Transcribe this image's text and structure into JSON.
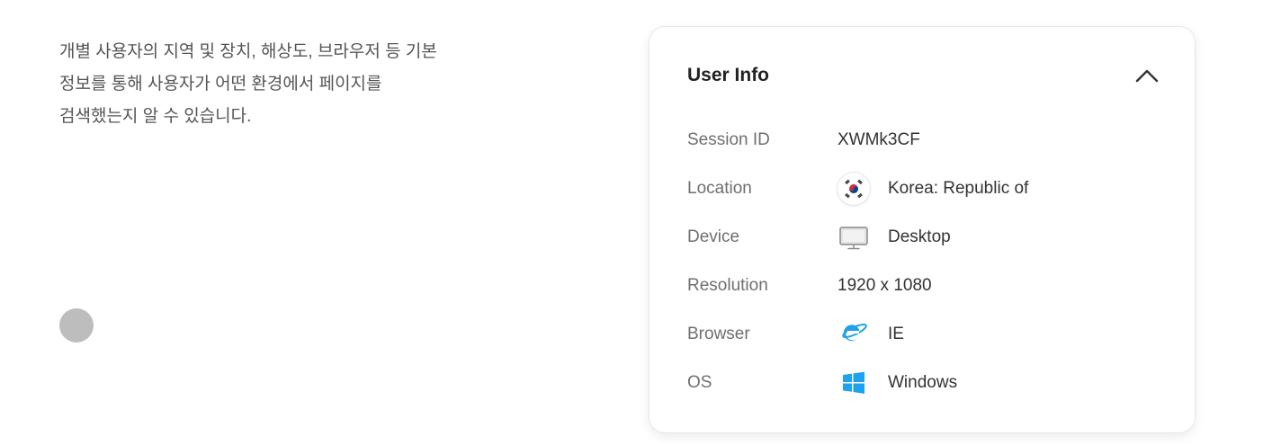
{
  "description": {
    "lines": [
      "개별 사용자의 지역 및 장치, 해상도, 브라우저 등 기본",
      "정보를 통해 사용자가 어떤 환경에서 페이지를",
      "검색했는지 알 수 있습니다."
    ]
  },
  "card": {
    "title": "User Info",
    "collapse_icon": "chevron-up-icon",
    "rows": [
      {
        "label": "Session ID",
        "value": "XWMk3CF",
        "icon": ""
      },
      {
        "label": "Location",
        "value": "Korea: Republic of",
        "icon": "korea-flag-icon"
      },
      {
        "label": "Device",
        "value": "Desktop",
        "icon": "monitor-icon"
      },
      {
        "label": "Resolution",
        "value": "1920 x 1080",
        "icon": ""
      },
      {
        "label": "Browser",
        "value": "IE",
        "icon": "internet-explorer-icon"
      },
      {
        "label": "OS",
        "value": "Windows",
        "icon": "windows-icon"
      }
    ]
  },
  "colors": {
    "label_gray": "#6f6f6f",
    "value_dark": "#333333",
    "ie_blue": "#1ea1e6",
    "windows_blue": "#1ea1f0",
    "dot_gray": "#bdbdbd"
  }
}
